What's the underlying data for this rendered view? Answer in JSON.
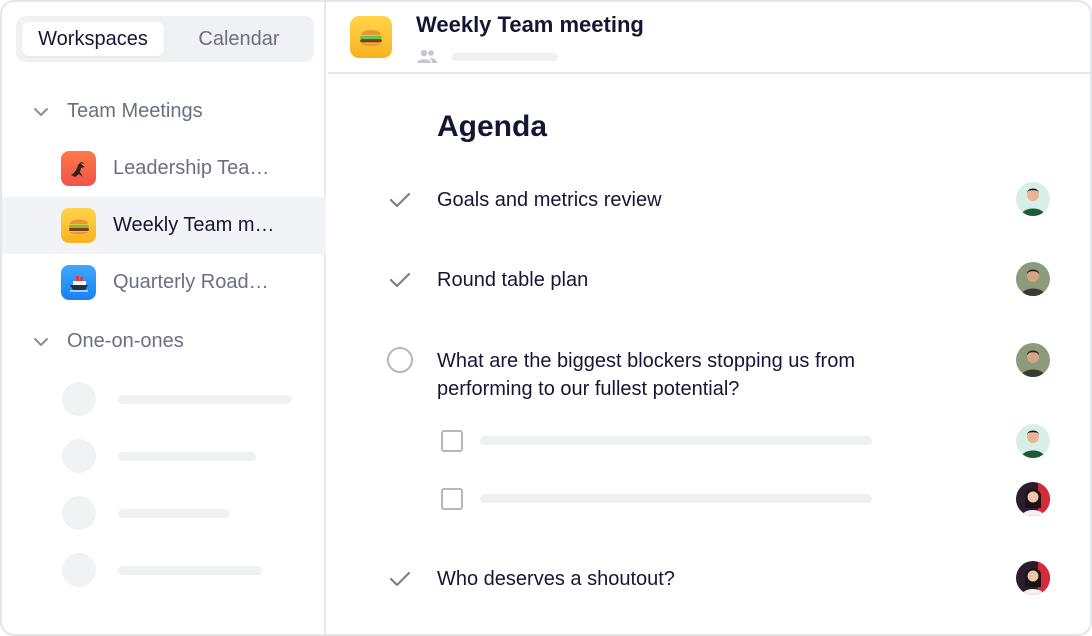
{
  "sidebar": {
    "tabs": [
      {
        "label": "Workspaces",
        "active": true
      },
      {
        "label": "Calendar",
        "active": false
      }
    ],
    "groups": [
      {
        "label": "Team Meetings",
        "expanded": true,
        "items": [
          {
            "label": "Leadership Tea…",
            "icon": "eagle-icon",
            "selected": false
          },
          {
            "label": "Weekly Team m…",
            "icon": "burger-icon",
            "selected": true
          },
          {
            "label": "Quarterly Road…",
            "icon": "ship-icon",
            "selected": false
          }
        ]
      },
      {
        "label": "One-on-ones",
        "expanded": true,
        "items": []
      }
    ]
  },
  "header": {
    "title": "Weekly Team meeting",
    "icon": "burger-icon"
  },
  "agenda": {
    "title": "Agenda",
    "items": [
      {
        "text": "Goals and metrics review",
        "status": "done",
        "avatar": "avatar-man-green"
      },
      {
        "text": "Round table plan",
        "status": "done",
        "avatar": "avatar-man-outdoor"
      },
      {
        "text": "What are the biggest blockers stopping us from performing to our fullest potential?",
        "status": "open",
        "avatar": "avatar-man-outdoor",
        "subitems": [
          {
            "checked": false,
            "avatar": "avatar-man-green"
          },
          {
            "checked": false,
            "avatar": "avatar-woman-red"
          }
        ]
      },
      {
        "text": "Who deserves a shoutout?",
        "status": "done",
        "avatar": "avatar-woman-red"
      }
    ]
  },
  "colors": {
    "accent_text": "#141733",
    "muted_text": "#6b6f82",
    "selected_bg": "#f2f3f6",
    "check": "#7b7f90"
  }
}
